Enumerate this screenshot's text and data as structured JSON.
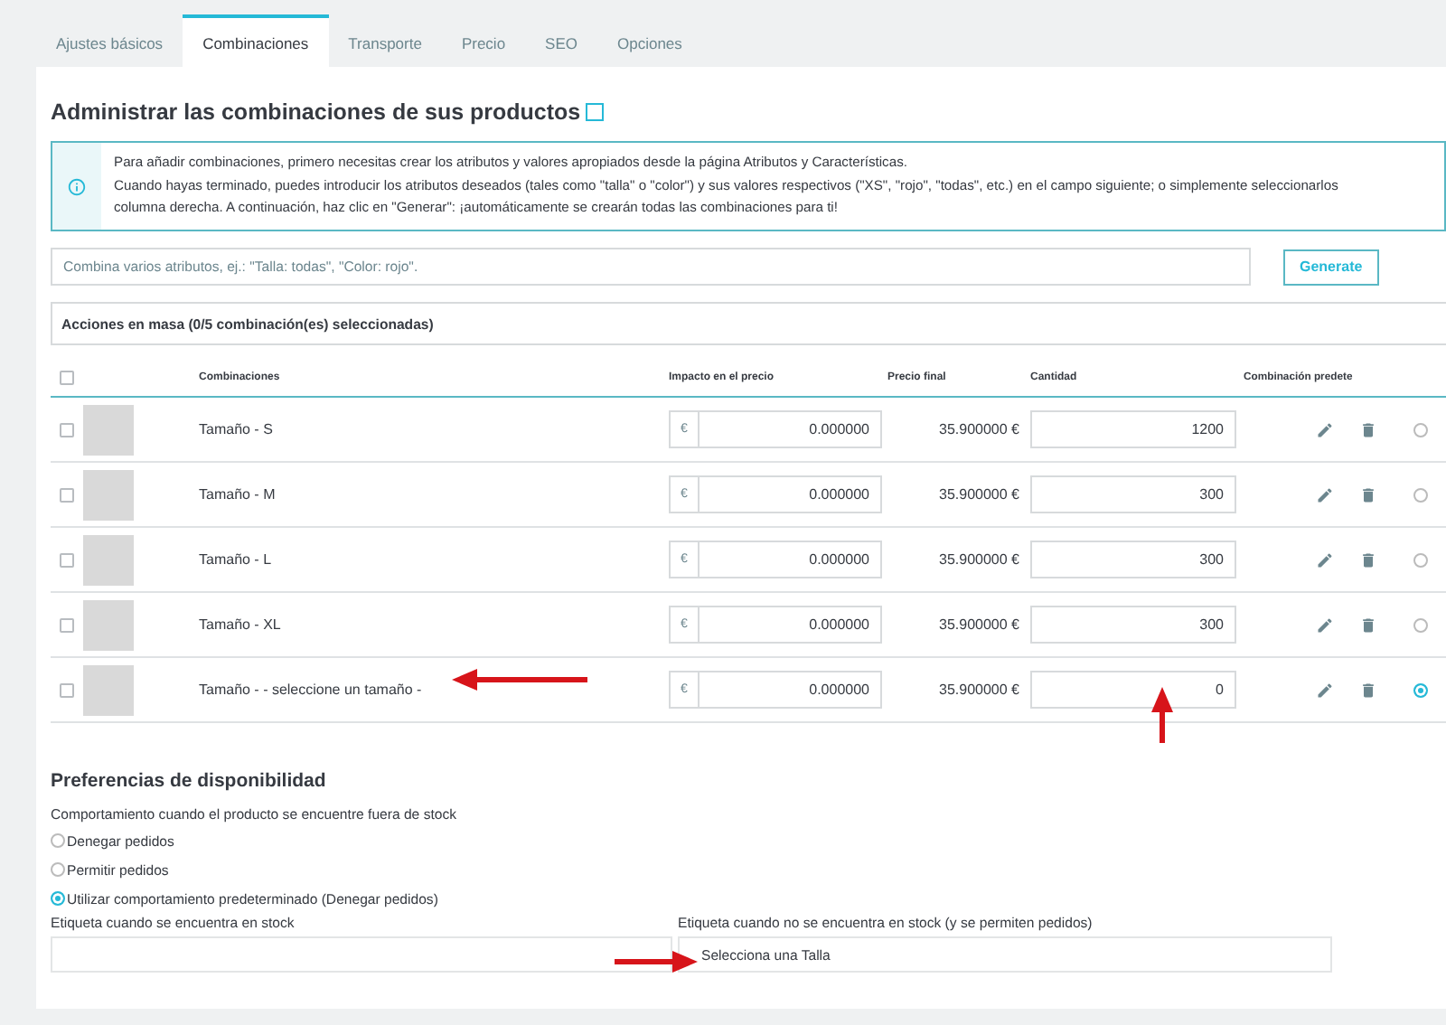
{
  "tabs": [
    {
      "label": "Ajustes básicos",
      "selected": false
    },
    {
      "label": "Combinaciones",
      "selected": true
    },
    {
      "label": "Transporte",
      "selected": false
    },
    {
      "label": "Precio",
      "selected": false
    },
    {
      "label": "SEO",
      "selected": false
    },
    {
      "label": "Opciones",
      "selected": false
    }
  ],
  "section_title": "Administrar las combinaciones de sus productos",
  "info_lines": [
    "Para añadir combinaciones, primero necesitas crear los atributos y valores apropiados desde la página Atributos y Características.",
    "Cuando hayas terminado, puedes introducir los atributos deseados (tales como \"talla\" o \"color\") y sus valores respectivos (\"XS\", \"rojo\", \"todas\", etc.) en el campo siguiente; o simplemente seleccionarlos",
    "columna derecha. A continuación, haz clic en \"Generar\": ¡automáticamente se crearán todas las combinaciones para ti!"
  ],
  "generator": {
    "placeholder": "Combina varios atributos, ej.: \"Talla: todas\", \"Color: rojo\".",
    "button": "Generate"
  },
  "bulk_actions": "Acciones en masa (0/5 combinación(es) seleccionadas)",
  "table": {
    "select_all": {
      "checked": false
    },
    "columns": [
      "Combinaciones",
      "Impacto en el precio",
      "Precio final",
      "Cantidad",
      "Combinación predete"
    ],
    "rows": [
      {
        "checked": false,
        "name": "Tamaño - S",
        "currency": "€",
        "impact": "0.000000",
        "final_price": "35.900000 €",
        "quantity": "1200",
        "selected": false
      },
      {
        "checked": false,
        "name": "Tamaño - M",
        "currency": "€",
        "impact": "0.000000",
        "final_price": "35.900000 €",
        "quantity": "300",
        "selected": false
      },
      {
        "checked": false,
        "name": "Tamaño - L",
        "currency": "€",
        "impact": "0.000000",
        "final_price": "35.900000 €",
        "quantity": "300",
        "selected": false
      },
      {
        "checked": false,
        "name": "Tamaño - XL",
        "currency": "€",
        "impact": "0.000000",
        "final_price": "35.900000 €",
        "quantity": "300",
        "selected": false
      },
      {
        "checked": false,
        "name": "Tamaño - - seleccione un tamaño -",
        "currency": "€",
        "impact": "0.000000",
        "final_price": "35.900000 €",
        "quantity": "0",
        "selected": true
      }
    ]
  },
  "availability": {
    "title": "Preferencias de disponibilidad",
    "label": "Comportamiento cuando el producto se encuentre fuera de stock",
    "options": [
      {
        "label": "Denegar pedidos",
        "selected": false
      },
      {
        "label": "Permitir pedidos",
        "selected": false
      },
      {
        "label": "Utilizar comportamiento predeterminado (Denegar pedidos)",
        "selected": true
      }
    ],
    "fields": [
      {
        "label": "Etiqueta cuando se encuentra en stock"
      },
      {
        "label": "Etiqueta cuando no se encuentra en stock (y se permiten pedidos)",
        "value": "Selecciona una Talla"
      }
    ]
  }
}
